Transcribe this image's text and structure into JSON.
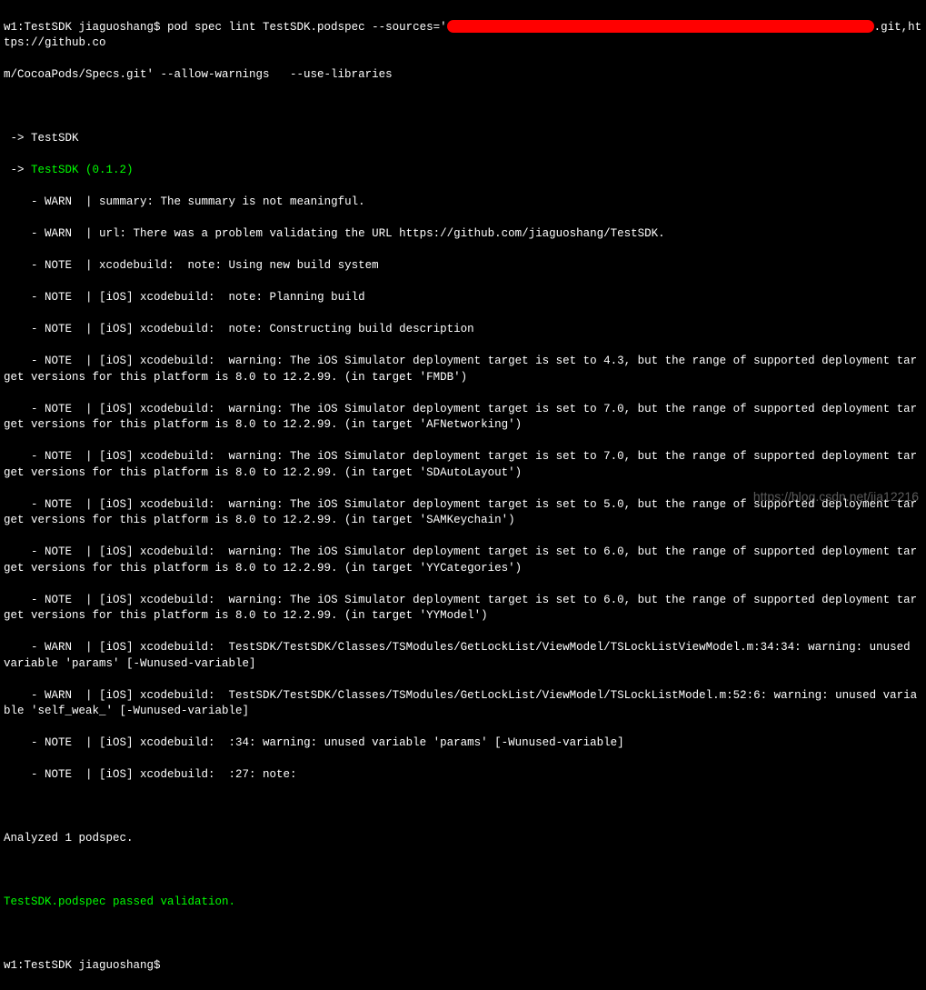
{
  "prompt1": {
    "path": "w1:TestSDK jiaguoshang$ ",
    "cmd_part1": "pod spec lint TestSDK.podspec --sources='",
    "cmd_part2": ".git,https://github.co",
    "cmd_line2": "m/CocoaPods/Specs.git' --allow-warnings   --use-libraries"
  },
  "blank1": " ",
  "output": {
    "l1": " -> TestSDK",
    "l2_a": " -> ",
    "l2_b": "TestSDK (0.1.2)",
    "l3": "    - WARN  | summary: The summary is not meaningful.",
    "l4": "    - WARN  | url: There was a problem validating the URL https://github.com/jiaguoshang/TestSDK.",
    "l5": "    - NOTE  | xcodebuild:  note: Using new build system",
    "l6": "    - NOTE  | [iOS] xcodebuild:  note: Planning build",
    "l7": "    - NOTE  | [iOS] xcodebuild:  note: Constructing build description",
    "l8": "    - NOTE  | [iOS] xcodebuild:  warning: The iOS Simulator deployment target is set to 4.3, but the range of supported deployment target versions for this platform is 8.0 to 12.2.99. (in target 'FMDB')",
    "l9": "    - NOTE  | [iOS] xcodebuild:  warning: The iOS Simulator deployment target is set to 7.0, but the range of supported deployment target versions for this platform is 8.0 to 12.2.99. (in target 'AFNetworking')",
    "l10": "    - NOTE  | [iOS] xcodebuild:  warning: The iOS Simulator deployment target is set to 7.0, but the range of supported deployment target versions for this platform is 8.0 to 12.2.99. (in target 'SDAutoLayout')",
    "l11": "    - NOTE  | [iOS] xcodebuild:  warning: The iOS Simulator deployment target is set to 5.0, but the range of supported deployment target versions for this platform is 8.0 to 12.2.99. (in target 'SAMKeychain')",
    "l12": "    - NOTE  | [iOS] xcodebuild:  warning: The iOS Simulator deployment target is set to 6.0, but the range of supported deployment target versions for this platform is 8.0 to 12.2.99. (in target 'YYCategories')",
    "l13": "    - NOTE  | [iOS] xcodebuild:  warning: The iOS Simulator deployment target is set to 6.0, but the range of supported deployment target versions for this platform is 8.0 to 12.2.99. (in target 'YYModel')",
    "l14": "    - WARN  | [iOS] xcodebuild:  TestSDK/TestSDK/Classes/TSModules/GetLockList/ViewModel/TSLockListViewModel.m:34:34: warning: unused variable 'params' [-Wunused-variable]",
    "l15": "    - WARN  | [iOS] xcodebuild:  TestSDK/TestSDK/Classes/TSModules/GetLockList/ViewModel/TSLockListModel.m:52:6: warning: unused variable 'self_weak_' [-Wunused-variable]",
    "l16": "    - NOTE  | [iOS] xcodebuild:  :34: warning: unused variable 'params' [-Wunused-variable]",
    "l17": "    - NOTE  | [iOS] xcodebuild:  :27: note:",
    "blank2": " ",
    "l18": "Analyzed 1 podspec.",
    "blank3": " ",
    "l19": "TestSDK.podspec passed validation.",
    "blank4": " "
  },
  "prompt2": "w1:TestSDK jiaguoshang$",
  "watermark": "https://blog.csdn.net/jia12216"
}
